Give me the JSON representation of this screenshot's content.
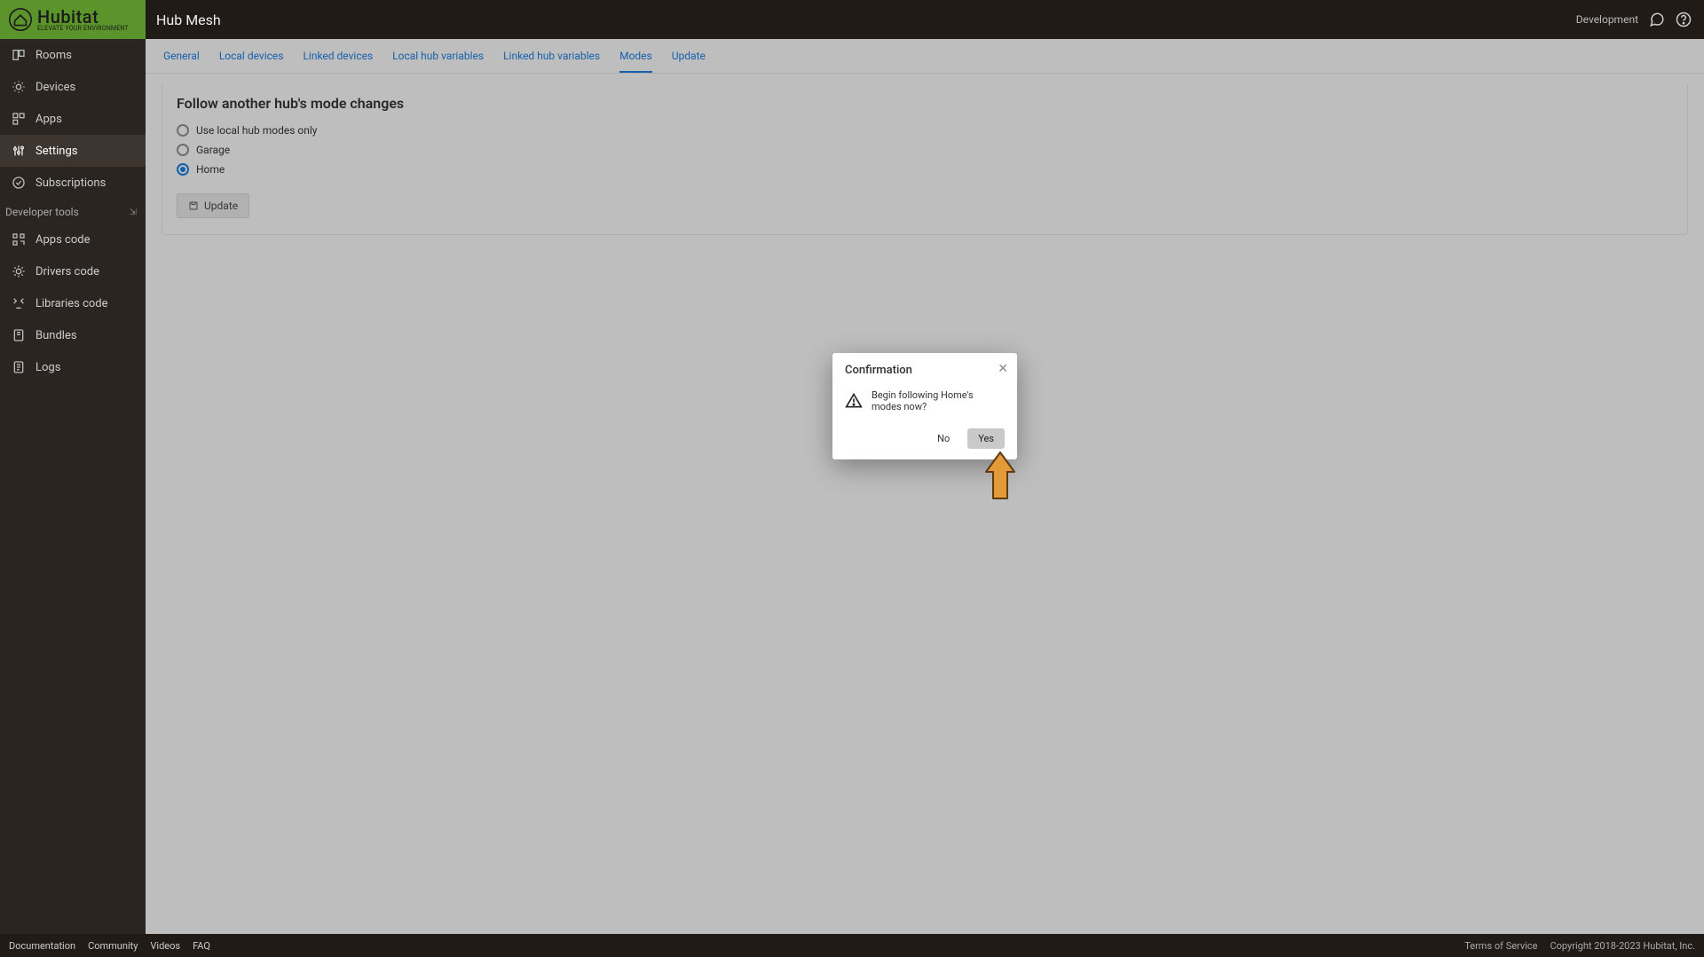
{
  "header": {
    "brand_main": "Hubitat",
    "brand_sub": "ELEVATE YOUR ENVIRONMENT",
    "page_title": "Hub Mesh",
    "env_label": "Development"
  },
  "sidebar": {
    "items": [
      {
        "label": "Rooms",
        "icon": "rooms"
      },
      {
        "label": "Devices",
        "icon": "devices"
      },
      {
        "label": "Apps",
        "icon": "apps"
      },
      {
        "label": "Settings",
        "icon": "settings",
        "active": true
      },
      {
        "label": "Subscriptions",
        "icon": "subs"
      }
    ],
    "dev_section": "Developer tools",
    "dev_items": [
      {
        "label": "Apps code",
        "icon": "appscode"
      },
      {
        "label": "Drivers code",
        "icon": "driverscode"
      },
      {
        "label": "Libraries code",
        "icon": "libs"
      },
      {
        "label": "Bundles",
        "icon": "bundles"
      },
      {
        "label": "Logs",
        "icon": "logs"
      }
    ]
  },
  "tabs": [
    {
      "label": "General"
    },
    {
      "label": "Local devices"
    },
    {
      "label": "Linked devices"
    },
    {
      "label": "Local hub variables"
    },
    {
      "label": "Linked hub variables"
    },
    {
      "label": "Modes",
      "active": true
    },
    {
      "label": "Update"
    }
  ],
  "panel": {
    "heading": "Follow another hub's mode changes",
    "options": [
      {
        "label": "Use local hub modes only",
        "selected": false
      },
      {
        "label": "Garage",
        "selected": false
      },
      {
        "label": "Home",
        "selected": true
      }
    ],
    "update_btn": "Update"
  },
  "dialog": {
    "title": "Confirmation",
    "message": "Begin following Home's modes now?",
    "no": "No",
    "yes": "Yes"
  },
  "footer": {
    "links": [
      "Documentation",
      "Community",
      "Videos",
      "FAQ"
    ],
    "terms": "Terms of Service",
    "copyright": "Copyright 2018-2023 Hubitat, Inc."
  }
}
